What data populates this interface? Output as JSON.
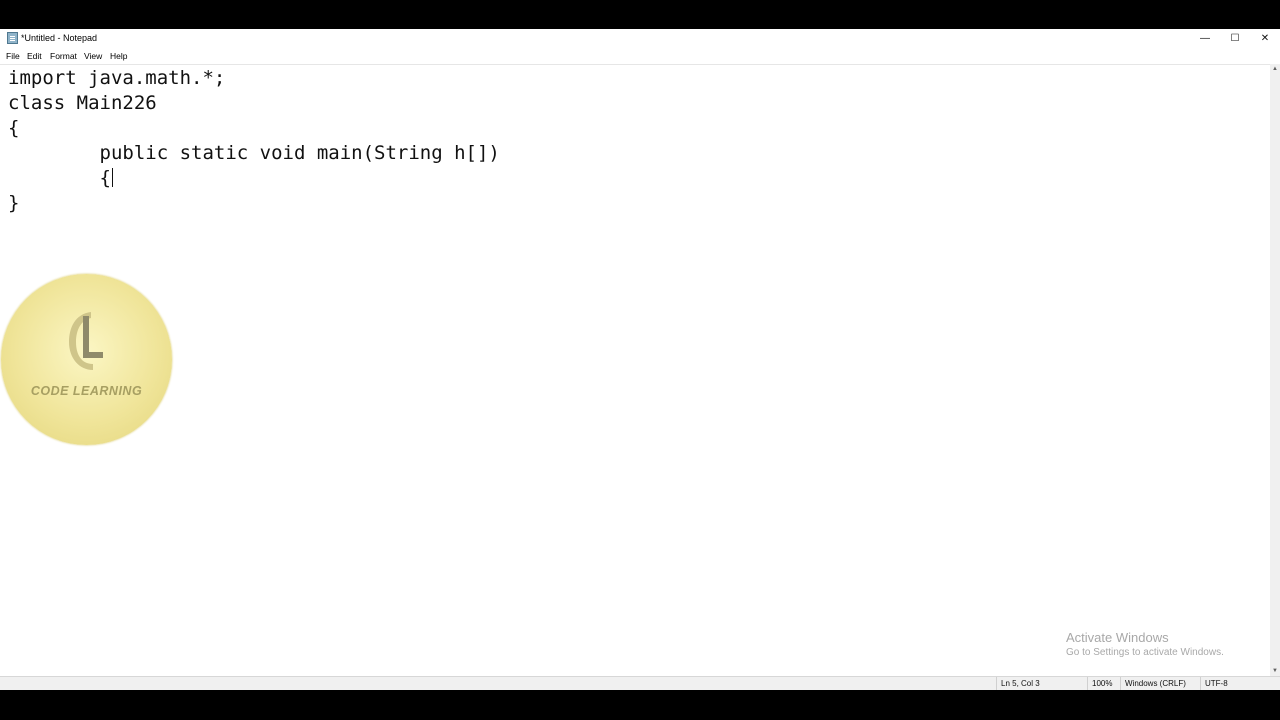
{
  "window": {
    "title": "*Untitled - Notepad",
    "controls": {
      "minimize": "—",
      "maximize": "☐",
      "close": "✕"
    }
  },
  "menu": {
    "items": [
      "File",
      "Edit",
      "Format",
      "View",
      "Help"
    ]
  },
  "editor": {
    "lines": [
      "import java.math.*;",
      "class Main226",
      "{",
      "        public static void main(String h[])",
      "        {",
      "}"
    ]
  },
  "status": {
    "position": "Ln 5, Col 3",
    "zoom": "100%",
    "line_ending": "Windows (CRLF)",
    "encoding": "UTF-8"
  },
  "overlay": {
    "activate_title": "Activate Windows",
    "activate_subtitle": "Go to Settings to activate Windows."
  },
  "watermark": {
    "text": "CODE LEARNING",
    "color": "#f0e59a"
  },
  "icons": {
    "app": "notepad-icon",
    "scroll_up": "▲",
    "scroll_down": "▼"
  }
}
